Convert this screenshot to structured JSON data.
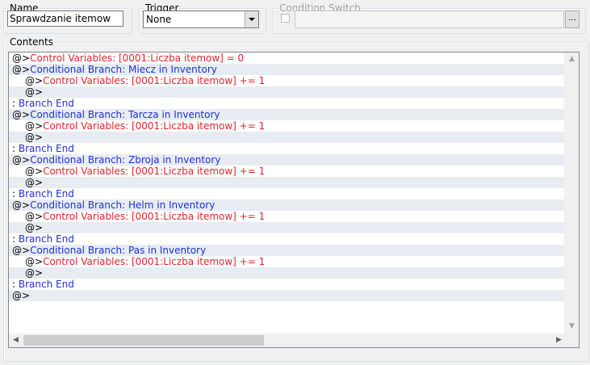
{
  "name_group": {
    "legend": "Name",
    "value": "Sprawdzanie itemow"
  },
  "trigger_group": {
    "legend": "Trigger",
    "value": "None"
  },
  "condition_group": {
    "legend": "Condition Switch",
    "button": "..."
  },
  "contents_group": {
    "legend": "Contents"
  },
  "list": {
    "rows": [
      {
        "indent": 0,
        "marker": "@>",
        "text": "Control Variables: [0001:Liczba itemow] = 0",
        "kind": "red"
      },
      {
        "indent": 0,
        "marker": "@>",
        "text": "Conditional Branch: Miecz in Inventory",
        "kind": "blue"
      },
      {
        "indent": 1,
        "marker": "@>",
        "text": "Control Variables: [0001:Liczba itemow] += 1",
        "kind": "red"
      },
      {
        "indent": 1,
        "marker": "@>",
        "text": "",
        "kind": "plain"
      },
      {
        "indent": 0,
        "marker": " : ",
        "text": "Branch End",
        "kind": "end"
      },
      {
        "indent": 0,
        "marker": "@>",
        "text": "Conditional Branch: Tarcza in Inventory",
        "kind": "blue"
      },
      {
        "indent": 1,
        "marker": "@>",
        "text": "Control Variables: [0001:Liczba itemow] += 1",
        "kind": "red"
      },
      {
        "indent": 1,
        "marker": "@>",
        "text": "",
        "kind": "plain"
      },
      {
        "indent": 0,
        "marker": " : ",
        "text": "Branch End",
        "kind": "end"
      },
      {
        "indent": 0,
        "marker": "@>",
        "text": "Conditional Branch: Zbroja in Inventory",
        "kind": "blue"
      },
      {
        "indent": 1,
        "marker": "@>",
        "text": "Control Variables: [0001:Liczba itemow] += 1",
        "kind": "red"
      },
      {
        "indent": 1,
        "marker": "@>",
        "text": "",
        "kind": "plain"
      },
      {
        "indent": 0,
        "marker": " : ",
        "text": "Branch End",
        "kind": "end"
      },
      {
        "indent": 0,
        "marker": "@>",
        "text": "Conditional Branch: Helm in Inventory",
        "kind": "blue"
      },
      {
        "indent": 1,
        "marker": "@>",
        "text": "Control Variables: [0001:Liczba itemow] += 1",
        "kind": "red"
      },
      {
        "indent": 1,
        "marker": "@>",
        "text": "",
        "kind": "plain"
      },
      {
        "indent": 0,
        "marker": " : ",
        "text": "Branch End",
        "kind": "end"
      },
      {
        "indent": 0,
        "marker": "@>",
        "text": "Conditional Branch: Pas in Inventory",
        "kind": "blue"
      },
      {
        "indent": 1,
        "marker": "@>",
        "text": "Control Variables: [0001:Liczba itemow] += 1",
        "kind": "red"
      },
      {
        "indent": 1,
        "marker": "@>",
        "text": "",
        "kind": "plain"
      },
      {
        "indent": 0,
        "marker": " : ",
        "text": "Branch End",
        "kind": "end"
      },
      {
        "indent": 0,
        "marker": "@>",
        "text": "",
        "kind": "plain"
      }
    ]
  },
  "colors": {
    "command_red": "#e0262e",
    "branch_blue": "#1f2fdb",
    "alt_row": "#e7ecf2",
    "window_bg": "#f0f0f0"
  },
  "icons": {
    "dropdown": "chevron-down-icon",
    "scroll_up": "scroll-up-icon",
    "scroll_down": "scroll-down-icon",
    "scroll_left": "scroll-left-icon",
    "scroll_right": "scroll-right-icon"
  }
}
